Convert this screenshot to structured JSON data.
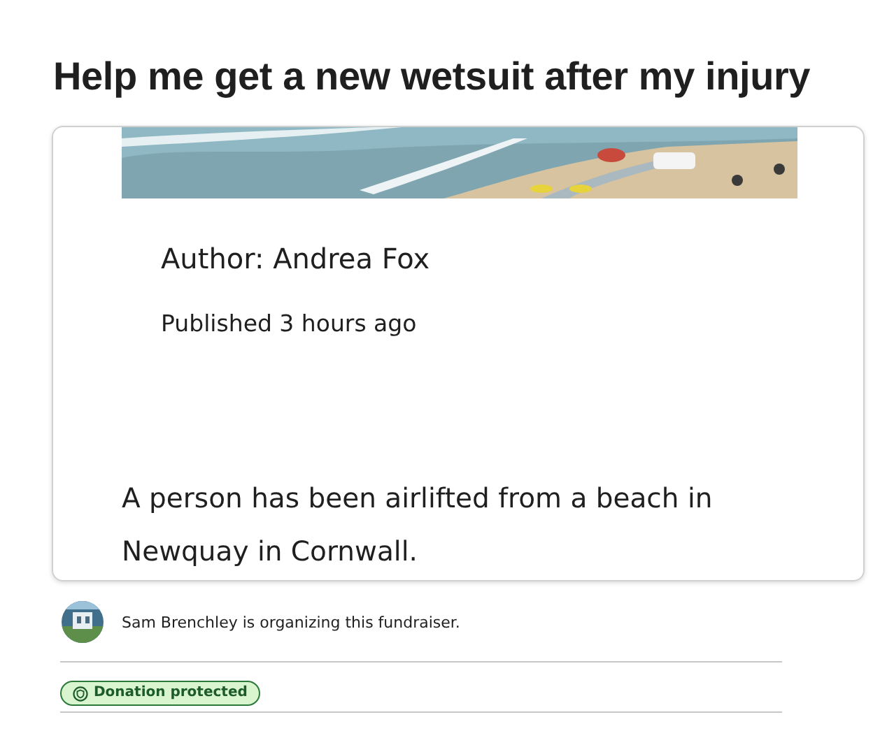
{
  "title": "Help me get a new wetsuit after my injury",
  "article": {
    "author": "Author: Andrea Fox",
    "published": "Published 3 hours ago",
    "text": "A person has been airlifted from a beach in Newquay in Cornwall."
  },
  "organizer": {
    "text": "Sam Brenchley is organizing this fundraiser."
  },
  "badge": {
    "label": "Donation protected"
  }
}
